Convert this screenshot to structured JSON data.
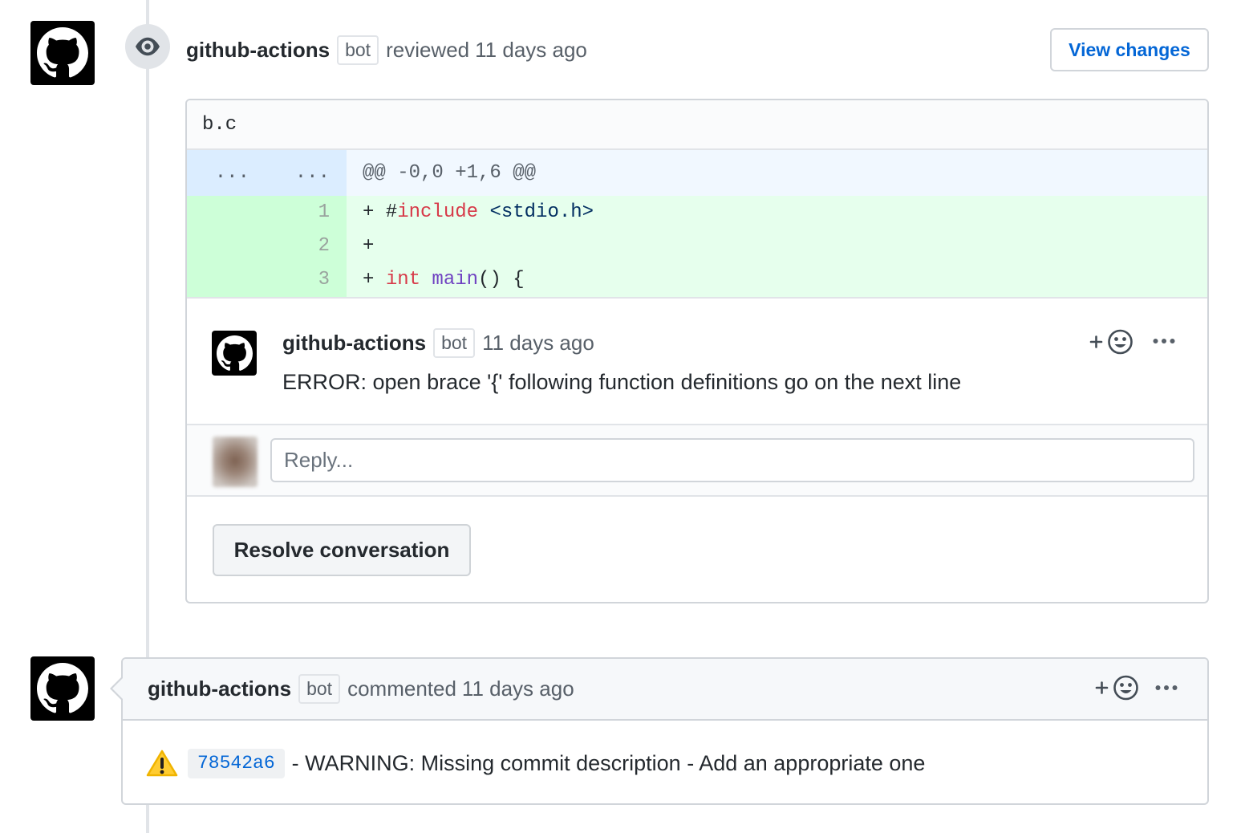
{
  "review": {
    "author": "github-actions",
    "author_badge": "bot",
    "action": "reviewed",
    "time": "11 days ago",
    "view_changes_label": "View changes",
    "file_name": "b.c",
    "diff": {
      "hunk": {
        "old_num": "...",
        "new_num": "...",
        "header": "@@ -0,0 +1,6 @@"
      },
      "lines": [
        {
          "new_num": "1",
          "tokens": [
            {
              "text": "+ #",
              "type": "plain"
            },
            {
              "text": "include",
              "type": "keyword"
            },
            {
              "text": " <stdio.h>",
              "type": "string"
            }
          ]
        },
        {
          "new_num": "2",
          "tokens": [
            {
              "text": "+",
              "type": "plain"
            }
          ]
        },
        {
          "new_num": "3",
          "tokens": [
            {
              "text": "+ ",
              "type": "plain"
            },
            {
              "text": "int",
              "type": "keyword"
            },
            {
              "text": " main",
              "type": "entity"
            },
            {
              "text": "() {",
              "type": "plain"
            }
          ]
        }
      ]
    },
    "comment": {
      "author": "github-actions",
      "author_badge": "bot",
      "time": "11 days ago",
      "body": "ERROR: open brace '{' following function definitions go on the next line"
    },
    "reply_placeholder": "Reply...",
    "resolve_label": "Resolve conversation"
  },
  "issue_comment": {
    "author": "github-actions",
    "author_badge": "bot",
    "action": "commented",
    "time": "11 days ago",
    "commit_sha": "78542a6",
    "body": "- WARNING: Missing commit description - Add an appropriate one"
  },
  "icons": {
    "avatar": "github-mark-icon",
    "review_event": "eye-icon",
    "add_reaction": "smiley-icon",
    "more_options": "kebab-horizontal-icon",
    "warning": "warning-icon"
  },
  "colors": {
    "link": "#0366d6",
    "text": "#24292e",
    "muted": "#586069",
    "border": "#d1d5da",
    "addition_bg": "#e6ffed",
    "addition_num_bg": "#cdffd8",
    "hunk_bg": "#f1f8ff",
    "hunk_num_bg": "#dbedff",
    "syntax_keyword": "#d73a49",
    "syntax_string": "#032f62",
    "syntax_entity": "#6f42c1",
    "warning": "#ffcc32"
  }
}
